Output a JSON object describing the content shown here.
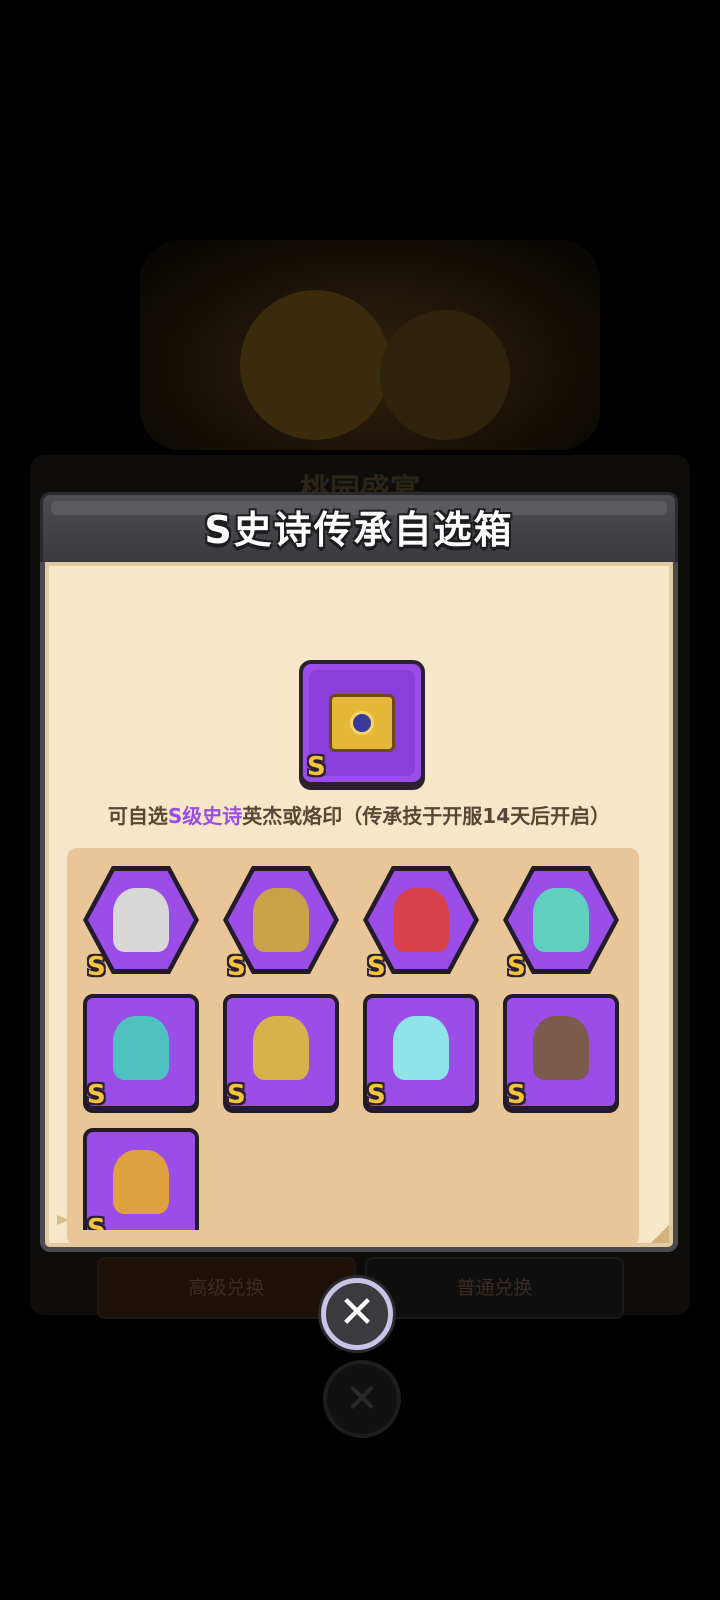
{
  "background": {
    "title": "桃园盛宴",
    "buttons": [
      {
        "label": "高级兑换"
      },
      {
        "label": "普通兑换"
      }
    ]
  },
  "modal": {
    "title": "S史诗传承自选箱",
    "chest": {
      "tier": "S",
      "icon": "treasure-chest-icon"
    },
    "description": {
      "prefix": "可自选",
      "highlight": "S级史诗",
      "suffix": "英杰或烙印（传承技于开服14天后开启）"
    },
    "heroes": [
      {
        "name": "reaper-hero",
        "tier": "S",
        "shape": "hex",
        "color": "#d8d8d8"
      },
      {
        "name": "knight-hero",
        "tier": "S",
        "shape": "hex",
        "color": "#c9a24a"
      },
      {
        "name": "demon-girl-hero",
        "tier": "S",
        "shape": "hex",
        "color": "#d9424a"
      },
      {
        "name": "spectral-armor-hero",
        "tier": "S",
        "shape": "hex",
        "color": "#5fd0c0"
      },
      {
        "name": "ghost-woman-imprint",
        "tier": "S",
        "shape": "square",
        "color": "#4fc1c1"
      },
      {
        "name": "pharaoh-skull-imprint",
        "tier": "S",
        "shape": "square",
        "color": "#d6b24a"
      },
      {
        "name": "ice-golem-imprint",
        "tier": "S",
        "shape": "square",
        "color": "#8fe4ea"
      },
      {
        "name": "stone-golem-imprint",
        "tier": "S",
        "shape": "square",
        "color": "#7a5b4c"
      },
      {
        "name": "crow-imprint",
        "tier": "S",
        "shape": "square",
        "color": "#e0a040"
      }
    ],
    "close_icon": "close-icon"
  },
  "colors": {
    "epic_purple": "#9b4de8",
    "tier_gold": "#f5c43a",
    "panel_cream": "#f7e6c8"
  }
}
